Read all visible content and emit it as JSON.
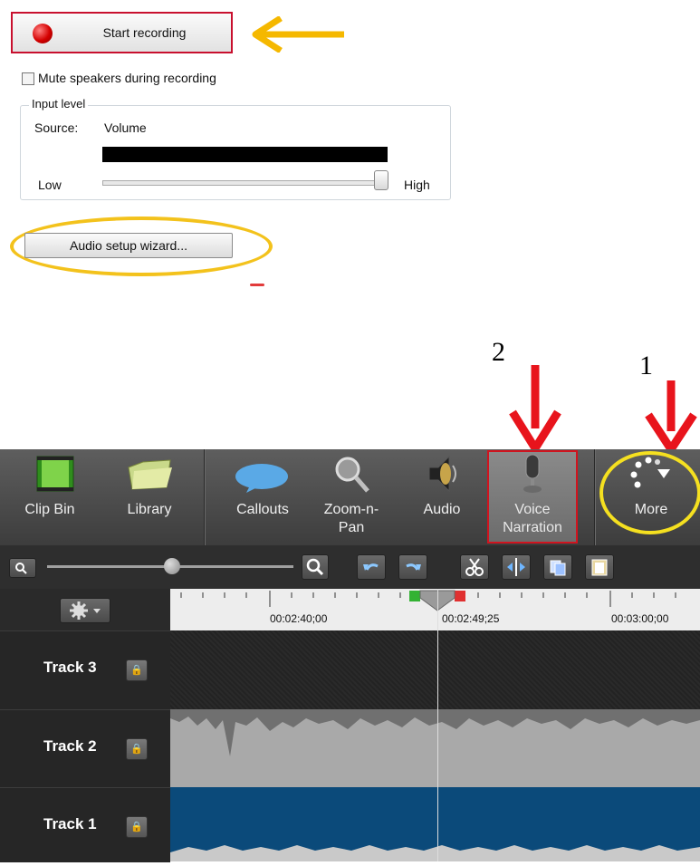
{
  "dialog": {
    "start_recording_label": "Start recording",
    "mute_label": "Mute speakers during recording",
    "input_level_title": "Input level",
    "source_key": "Source:",
    "source_value": "Volume",
    "low_label": "Low",
    "high_label": "High",
    "input_level_value": 1.0,
    "audio_wizard_label": "Audio setup wizard..."
  },
  "annotations": {
    "number_2": "2",
    "number_1": "1",
    "arrow_color": "#f5b800",
    "red_arrow_color": "#e8141c",
    "highlight_color": "#f3c21c"
  },
  "toolbar": {
    "items": [
      {
        "label": "Clip Bin",
        "icon": "film-strip-icon"
      },
      {
        "label": "Library",
        "icon": "folder-icon"
      },
      {
        "label": "Callouts",
        "icon": "speech-bubble-icon"
      },
      {
        "label": "Zoom-n-\nPan",
        "icon": "magnifier-icon"
      },
      {
        "label": "Audio",
        "icon": "speaker-icon"
      },
      {
        "label": "Voice\nNarration",
        "icon": "microphone-icon"
      },
      {
        "label": "More",
        "icon": "more-dots-icon"
      }
    ]
  },
  "timeline": {
    "ticks": [
      "00:02:40;00",
      "00:02:49;25",
      "00:03:00;00"
    ],
    "tracks": [
      {
        "name": "Track 3"
      },
      {
        "name": "Track 2"
      },
      {
        "name": "Track 1"
      }
    ]
  }
}
